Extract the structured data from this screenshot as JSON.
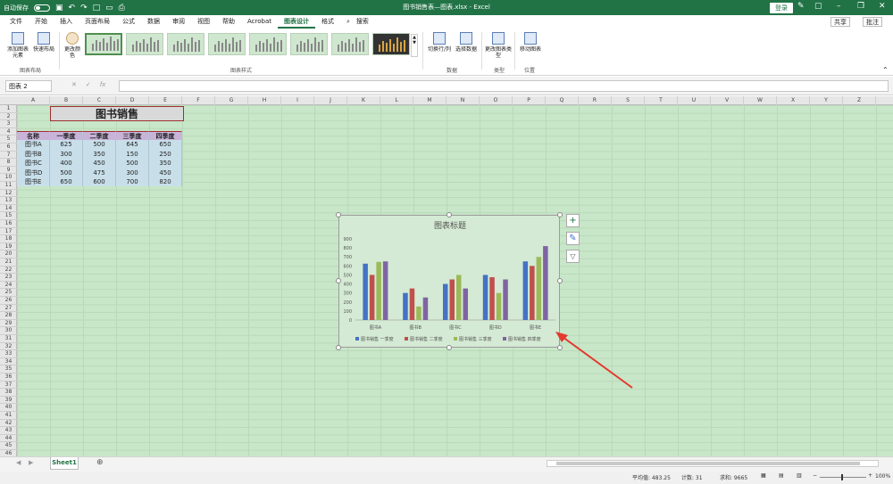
{
  "titlebar": {
    "autosave": "自动保存",
    "title": "图书销售表—图表.xlsx - Excel",
    "login": "登录"
  },
  "tabs": [
    "文件",
    "开始",
    "插入",
    "页面布局",
    "公式",
    "数据",
    "审阅",
    "视图",
    "帮助",
    "Acrobat",
    "图表设计",
    "格式"
  ],
  "search": "搜索",
  "share": "共享",
  "comment": "批注",
  "ribbon": {
    "add_element": "添加图表元素",
    "quick_layout": "快速布局",
    "change_color": "更改颜色",
    "switch_rowcol": "切换行/列",
    "select_data": "选择数据",
    "change_type": "更改图表类型",
    "move_chart": "移动图表",
    "groups": {
      "layout": "图表布局",
      "styles": "图表样式",
      "data": "数据",
      "type": "类型",
      "location": "位置"
    }
  },
  "namebox": "图表 2",
  "fx": "fx",
  "columns": [
    "A",
    "B",
    "C",
    "D",
    "E",
    "F",
    "G",
    "H",
    "I",
    "J",
    "K",
    "L",
    "M",
    "N",
    "O",
    "P",
    "Q",
    "R",
    "S",
    "T",
    "U",
    "V",
    "W",
    "X",
    "Y",
    "Z"
  ],
  "rows": [
    "1",
    "2",
    "3",
    "4",
    "5",
    "6",
    "7",
    "8",
    "9",
    "10",
    "11",
    "12",
    "13",
    "14",
    "15",
    "16",
    "17",
    "18",
    "19",
    "20",
    "21",
    "22",
    "23",
    "24",
    "25",
    "26",
    "27",
    "28",
    "29",
    "30",
    "31",
    "32",
    "33",
    "34",
    "35",
    "36",
    "37",
    "38",
    "39",
    "40",
    "41",
    "42",
    "43",
    "44",
    "45",
    "46"
  ],
  "table": {
    "title": "图书销售",
    "header": [
      "名称",
      "一季度",
      "二季度",
      "三季度",
      "四季度"
    ],
    "rows": [
      [
        "图书A",
        "625",
        "500",
        "645",
        "650"
      ],
      [
        "图书B",
        "300",
        "350",
        "150",
        "250"
      ],
      [
        "图书C",
        "400",
        "450",
        "500",
        "350"
      ],
      [
        "图书D",
        "500",
        "475",
        "300",
        "450"
      ],
      [
        "图书E",
        "650",
        "600",
        "700",
        "820"
      ]
    ]
  },
  "chart_data": {
    "type": "bar",
    "title": "图表标题",
    "categories": [
      "图书A",
      "图书B",
      "图书C",
      "图书D",
      "图书E"
    ],
    "series": [
      {
        "name": "图书销售 一季度",
        "values": [
          625,
          300,
          400,
          500,
          650
        ],
        "color": "#4472c4"
      },
      {
        "name": "图书销售 二季度",
        "values": [
          500,
          350,
          450,
          475,
          600
        ],
        "color": "#c0504d"
      },
      {
        "name": "图书销售 三季度",
        "values": [
          645,
          150,
          500,
          300,
          700
        ],
        "color": "#9bbb59"
      },
      {
        "name": "图书销售 四季度",
        "values": [
          650,
          250,
          350,
          450,
          820
        ],
        "color": "#8064a2"
      }
    ],
    "ylim": [
      0,
      900
    ],
    "yticks": [
      "0",
      "100",
      "200",
      "300",
      "400",
      "500",
      "600",
      "700",
      "800",
      "900"
    ],
    "legend": "bottom",
    "grid": false
  },
  "sheet_tab": "Sheet1",
  "status": {
    "average": "平均值: 483.25",
    "count": "计数: 31",
    "sum": "求和: 9665",
    "zoom": "100%"
  },
  "colors": {
    "accent": "#217346",
    "annotation_arrow": "#e23a2e"
  }
}
